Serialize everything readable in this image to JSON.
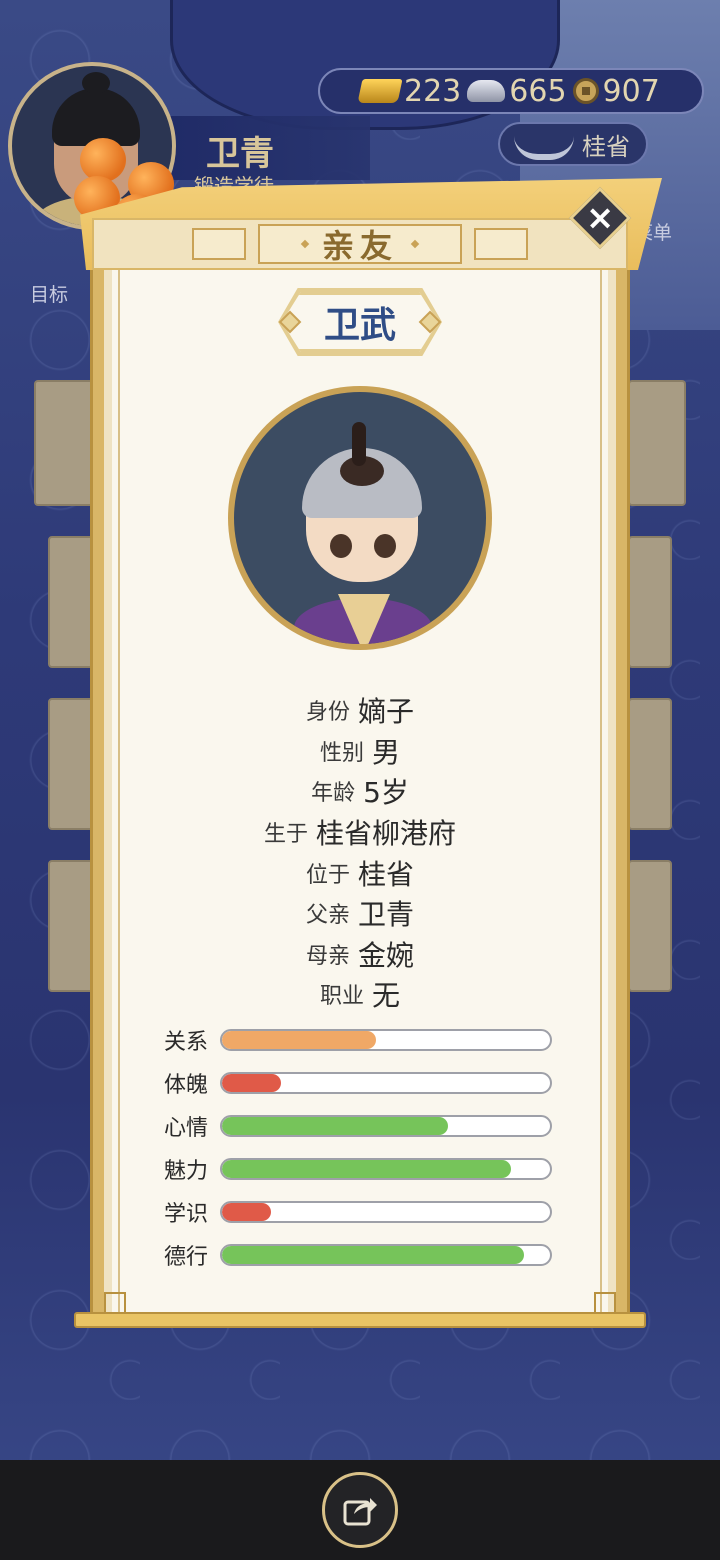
{
  "player": {
    "name": "卫青",
    "title": "锻造学徒"
  },
  "currency": {
    "gold": "223",
    "silver": "665",
    "coins": "907"
  },
  "location": "桂省",
  "hud": {
    "menu_label": "菜单",
    "goal_label": "目标"
  },
  "modal": {
    "tab_title": "亲友",
    "character_name": "卫武",
    "info": [
      {
        "label": "身份",
        "value": "嫡子"
      },
      {
        "label": "性别",
        "value": "男"
      },
      {
        "label": "年龄",
        "value": "5岁"
      },
      {
        "label": "生于",
        "value": "桂省柳港府"
      },
      {
        "label": "位于",
        "value": "桂省"
      },
      {
        "label": "父亲",
        "value": "卫青"
      },
      {
        "label": "母亲",
        "value": "金婉"
      },
      {
        "label": "职业",
        "value": "无"
      }
    ],
    "stats": [
      {
        "label": "关系",
        "value": 0.47,
        "color": "#f0a866"
      },
      {
        "label": "体魄",
        "value": 0.18,
        "color": "#e05a48"
      },
      {
        "label": "心情",
        "value": 0.69,
        "color": "#76c45a"
      },
      {
        "label": "魅力",
        "value": 0.88,
        "color": "#76c45a"
      },
      {
        "label": "学识",
        "value": 0.15,
        "color": "#e05a48"
      },
      {
        "label": "德行",
        "value": 0.92,
        "color": "#76c45a"
      }
    ]
  },
  "icons": {
    "close": "close-icon",
    "share": "share-icon"
  }
}
